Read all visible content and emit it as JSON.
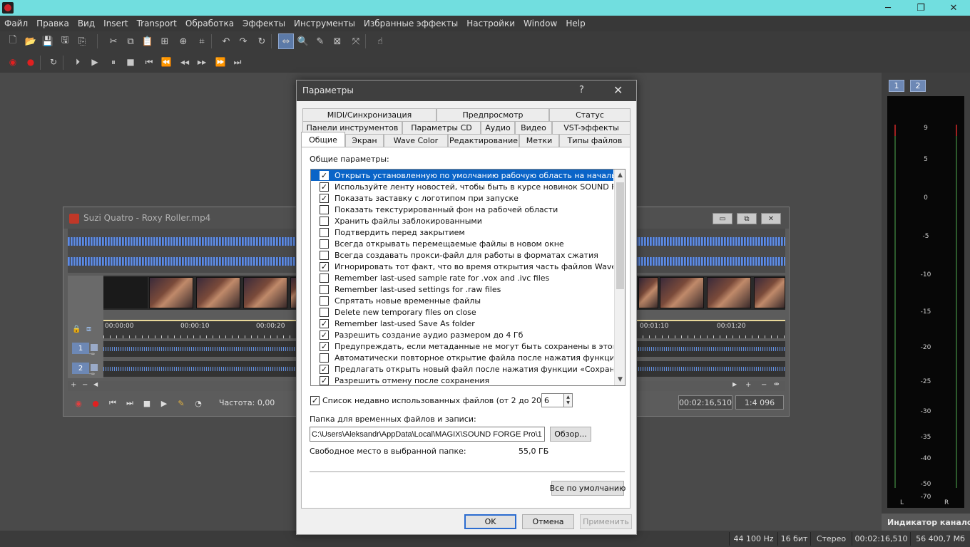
{
  "window": {
    "minimize_glyph": "─",
    "maximize_glyph": "❐",
    "close_glyph": "✕"
  },
  "menu": [
    "Файл",
    "Правка",
    "Вид",
    "Insert",
    "Transport",
    "Обработка",
    "Эффекты",
    "Инструменты",
    "Избранные эффекты",
    "Настройки",
    "Window",
    "Help"
  ],
  "toolbar_icons": [
    "new-file-icon",
    "open-folder-icon",
    "save-icon",
    "save-as-icon",
    "save-all-icon",
    "cut-icon",
    "copy-icon",
    "paste-icon",
    "paste-special-icon",
    "mix-icon",
    "crop-icon",
    "undo-icon",
    "redo-icon",
    "repeat-icon",
    "edit-tool-icon",
    "magnify-tool-icon",
    "pencil-tool-icon",
    "event-tool-icon",
    "envelope-tool-icon",
    "help-icon"
  ],
  "transport_icons": [
    "record-arm-icon",
    "record-icon",
    "loop-icon",
    "play-all-icon",
    "play-icon",
    "pause-icon",
    "stop-icon",
    "go-start-icon",
    "prev-marker-icon",
    "rewind-icon",
    "fast-forward-icon",
    "next-marker-icon",
    "go-end-icon"
  ],
  "meter": {
    "channels": [
      "1",
      "2"
    ],
    "scale": [
      "9",
      "5",
      "0",
      "-5",
      "-10",
      "-15",
      "-20",
      "-25",
      "-30",
      "-35",
      "-40",
      "-50",
      "-70"
    ],
    "lr": [
      "L",
      "R"
    ],
    "status": "Индикатор каналов"
  },
  "statusbar": {
    "sample_rate": "44 100 Hz",
    "bit_depth": "16 бит",
    "channels": "Стерео",
    "length": "00:02:16,510",
    "free_space": "56 400,7 Мб"
  },
  "document": {
    "title": "Suzi Quatro - Roxy Roller.mp4",
    "ruler": [
      "00:00:00",
      "00:00:10",
      "00:00:20",
      "00:01:10",
      "00:01:20"
    ],
    "channels": [
      "1",
      "2"
    ],
    "channel_db": "-∞",
    "frequency": "Частота: 0,00",
    "position": "00:02:16,510",
    "zoom": "1:4 096"
  },
  "dialog": {
    "title": "Параметры",
    "help": "?",
    "close": "✕",
    "tabs_row1": [
      "MIDI/Синхронизация",
      "Предпросмотр",
      "Статус"
    ],
    "tabs_row2": [
      "Панели инструментов",
      "Параметры CD",
      "Аудио",
      "Видео",
      "VST-эффекты"
    ],
    "tabs_row3": [
      "Общие",
      "Экран",
      "Wave Color",
      "Редактирование",
      "Метки",
      "Типы файлов"
    ],
    "group_label": "Общие параметры:",
    "options": [
      {
        "label": "Открыть установленную по умолчанию рабочую область на начальном этапе",
        "checked": true
      },
      {
        "label": "Используйте ленту новостей, чтобы быть в курсе новинок SOUND FORGE",
        "checked": true
      },
      {
        "label": "Показать заставку с логотипом при запуске",
        "checked": true
      },
      {
        "label": "Показать текстурированный фон на рабочей области",
        "checked": false
      },
      {
        "label": "Хранить файлы заблокированными",
        "checked": false
      },
      {
        "label": "Подтвердить перед закрытием",
        "checked": false
      },
      {
        "label": "Всегда открывать перемещаемые файлы в новом окне",
        "checked": false
      },
      {
        "label": "Всегда создавать прокси-файл для работы в форматах сжатия",
        "checked": false
      },
      {
        "label": "Игнорировать тот факт, что  во время открытия часть  файлов Wave будет",
        "checked": true
      },
      {
        "label": "Remember last-used sample rate for .vox and .ivc files",
        "checked": false
      },
      {
        "label": "Remember last-used settings for .raw files",
        "checked": false
      },
      {
        "label": "Спрятать новые временные файлы",
        "checked": false
      },
      {
        "label": "Delete new temporary files on close",
        "checked": false
      },
      {
        "label": "Remember last-used Save As folder",
        "checked": true
      },
      {
        "label": "Разрешить создание аудио размером до 4 Гб",
        "checked": true
      },
      {
        "label": "Предупреждать, если метаданные не могут быть сохранены в этом файле",
        "checked": true
      },
      {
        "label": "Автоматически повторное открытие файла после нажатия функции «Сохра",
        "checked": false
      },
      {
        "label": "Предлагать открыть новый файл после нажатия функции «Сохранить как»",
        "checked": true
      },
      {
        "label": "Разрешить отмену после сохранения",
        "checked": true
      }
    ],
    "recent_files_label": "Список недавно использованных файлов (от 2 до 20):",
    "recent_files_value": "6",
    "folder_label": "Папка для временных файлов и записи:",
    "folder_path": "C:\\Users\\Aleksandr\\AppData\\Local\\MAGIX\\SOUND FORGE Pro\\1",
    "browse_button": "Обзор...",
    "free_space_label": "Свободное место в выбранной папке:",
    "free_space_value": "55,0 ГБ",
    "defaults_button": "Все по умолчанию",
    "ok_button": "OK",
    "cancel_button": "Отмена",
    "apply_button": "Применить"
  }
}
